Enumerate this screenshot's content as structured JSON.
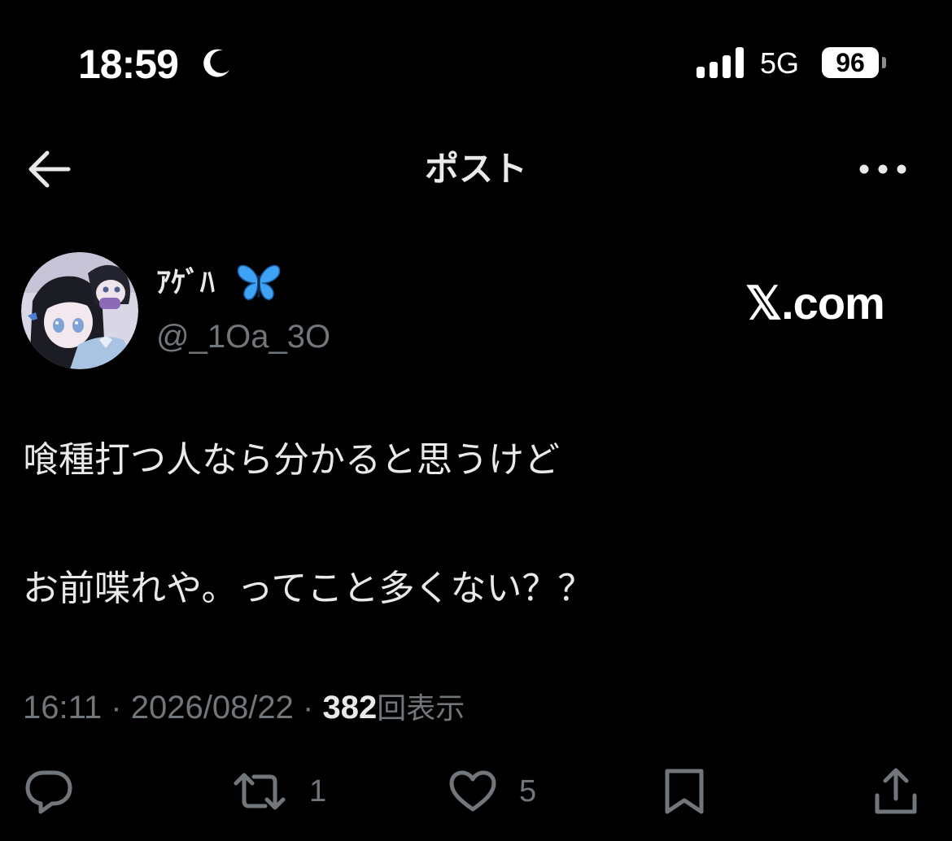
{
  "status_bar": {
    "time": "18:59",
    "network": "5G",
    "battery": "96"
  },
  "header": {
    "title": "ポスト"
  },
  "post": {
    "author": {
      "display_name": "ｱｹﾞﾊ",
      "handle": "@_1Oa_3O"
    },
    "brand_label": "𝕏.com",
    "text_lines": [
      "喰種打つ人なら分かると思うけど",
      "お前喋れや。ってこと多くない？？"
    ],
    "meta": {
      "time": "16:11",
      "separator": "·",
      "date": "2026/08/22",
      "views": "382",
      "views_label": "回表示"
    },
    "actions": {
      "reply_count": "",
      "repost_count": "1",
      "like_count": "5"
    }
  },
  "colors": {
    "background": "#000000",
    "text_primary": "#e7e9ea",
    "text_secondary": "#71767b",
    "icon_secondary": "#71767b"
  },
  "icons": {
    "back": "arrow-left-icon",
    "more": "more-dots-icon",
    "reply": "comment-icon",
    "repost": "repost-icon",
    "like": "heart-icon",
    "bookmark": "bookmark-icon",
    "share": "share-icon"
  }
}
